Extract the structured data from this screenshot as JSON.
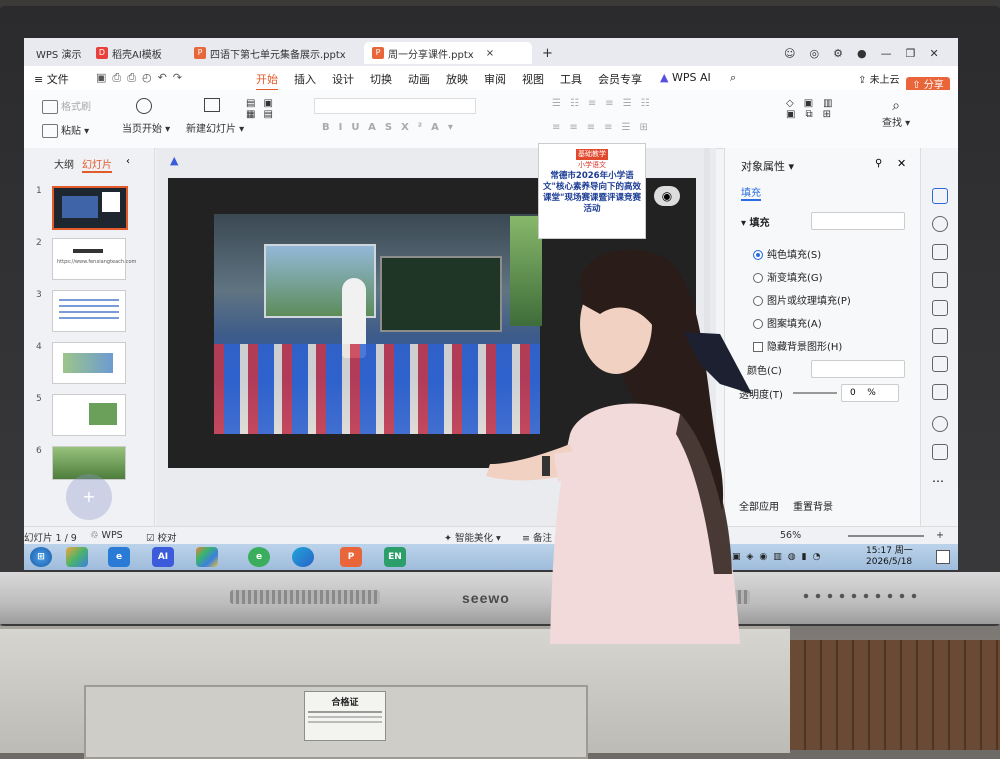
{
  "tabs": {
    "home": "WPS 演示",
    "template": "稻壳AI模板",
    "file1": "四语下第七单元集备展示.pptx",
    "file2": "周一分享课件.pptx",
    "add": "+"
  },
  "menu": {
    "file": "文件",
    "items": [
      "开始",
      "插入",
      "设计",
      "切换",
      "动画",
      "放映",
      "审阅",
      "视图",
      "工具",
      "会员专享"
    ],
    "active": "开始",
    "wps_ai": "WPS AI",
    "cloud": "未上云",
    "share": "分享"
  },
  "ribbon": {
    "format_painter": "格式刷",
    "paste": "粘贴",
    "start_from_current": "当页开始",
    "new_slide": "新建幻灯片",
    "find": "查找"
  },
  "left_pane": {
    "outline_tab": "大纲",
    "slides_tab": "幻灯片",
    "slide_numbers": [
      "1",
      "2",
      "3",
      "4",
      "5",
      "6"
    ],
    "thumb2_text": "https://www.fenxiangteach.com"
  },
  "slide": {
    "poster_tag": "基础教学",
    "poster_subject": "小学语文",
    "poster_title": "常德市2026年小学语文\"核心素养导向下的高效课堂\"现场赛课暨评课竞赛活动"
  },
  "right_panel": {
    "title": "对象属性",
    "fill_tab": "填充",
    "fill_section": "填充",
    "options": [
      "纯色填充(S)",
      "渐变填充(G)",
      "图片或纹理填充(P)",
      "图案填充(A)"
    ],
    "selected_option": "纯色填充(S)",
    "hide_bg": "隐藏背景图形(H)",
    "color_label": "颜色(C)",
    "transparency_label": "透明度(T)",
    "transparency_value": "0",
    "transparency_unit": "%",
    "apply_all": "全部应用",
    "reset_bg": "重置背景"
  },
  "statusbar": {
    "slide_count": "幻灯片 1 / 9",
    "theme": "WPS",
    "proofread": "校对",
    "beautify": "智能美化",
    "notes": "备注",
    "zoom": "56%"
  },
  "taskbar": {
    "ai_label": "AI",
    "en_label": "EN",
    "time": "15:17 周一",
    "date": "2026/5/18"
  },
  "hardware": {
    "brand": "seewo",
    "certificate_title": "合格证"
  },
  "colors": {
    "accent": "#e35a2b",
    "taskbar": "#a9c4e2",
    "ui_bg": "#f3f4f7"
  }
}
